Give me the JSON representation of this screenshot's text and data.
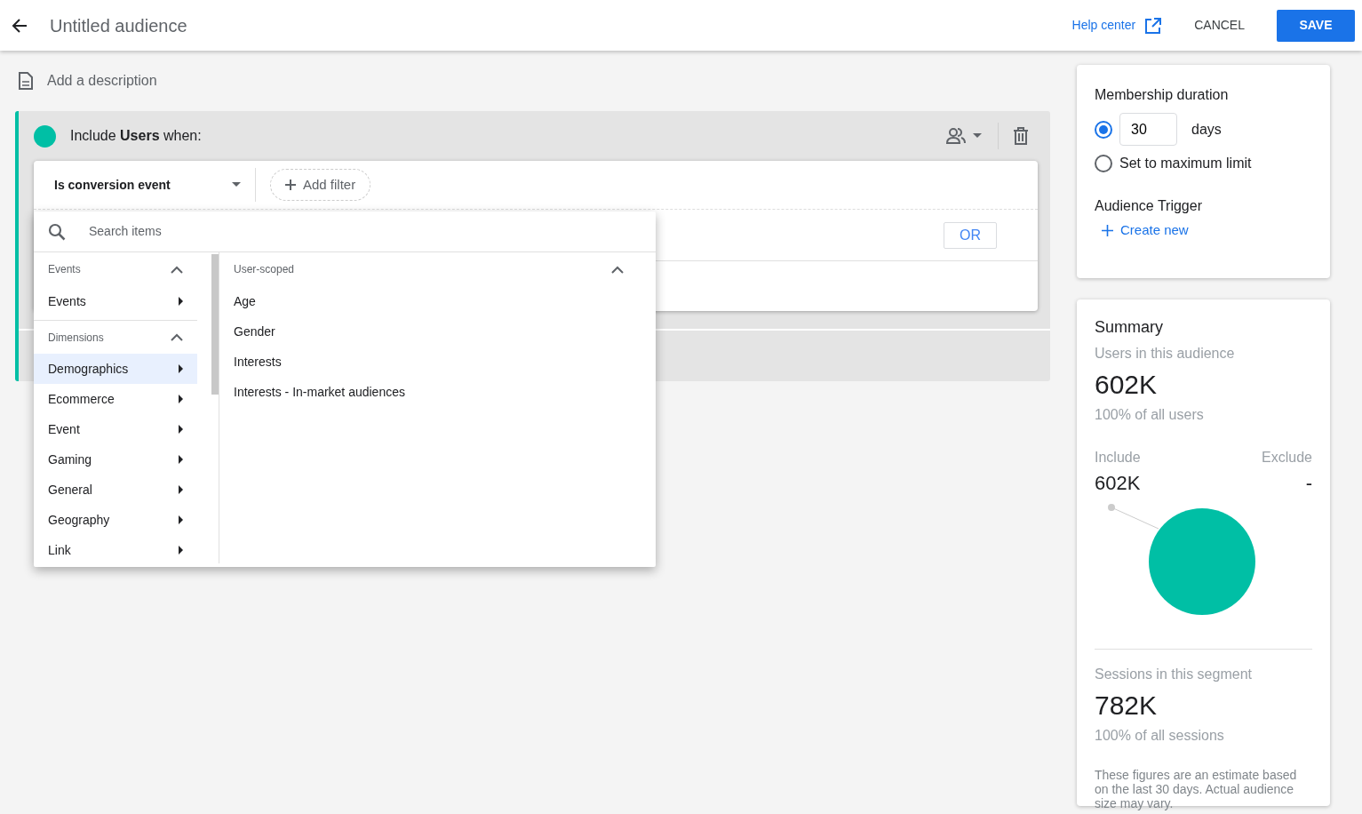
{
  "header": {
    "title": "Untitled audience",
    "help_link": "Help center",
    "cancel": "CANCEL",
    "save": "SAVE"
  },
  "description": {
    "placeholder": "Add a description"
  },
  "group": {
    "heading": "Include **Users** when:",
    "condition": "Is conversion event",
    "add_filter": "Add filter",
    "or_button": "OR"
  },
  "menu": {
    "search_placeholder": "Search items",
    "sections": [
      {
        "heading": "Events",
        "expanded": true,
        "items": [
          {
            "label": "Events",
            "selected": false
          }
        ]
      },
      {
        "heading": "Dimensions",
        "expanded": true,
        "items": [
          {
            "label": "Demographics",
            "selected": true
          },
          {
            "label": "Ecommerce",
            "selected": false
          },
          {
            "label": "Event",
            "selected": false
          },
          {
            "label": "Gaming",
            "selected": false
          },
          {
            "label": "General",
            "selected": false
          },
          {
            "label": "Geography",
            "selected": false
          },
          {
            "label": "Link",
            "selected": false
          }
        ]
      }
    ],
    "detail": {
      "heading": "User-scoped",
      "expanded": true,
      "items": [
        "Age",
        "Gender",
        "Interests",
        "Interests - In-market audiences"
      ]
    }
  },
  "membership": {
    "title": "Membership duration",
    "options": [
      {
        "kind": "days",
        "selected": true,
        "value": "30",
        "unit": "days"
      },
      {
        "kind": "label",
        "selected": false,
        "label": "Set to maximum limit"
      }
    ],
    "trigger_title": "Audience Trigger",
    "create_new": "Create new"
  },
  "summary": {
    "title": "Summary",
    "users_label": "Users in this audience",
    "users_value": "602K",
    "users_share": "100% of all users",
    "include_label": "Include",
    "include_value": "602K",
    "exclude_label": "Exclude",
    "exclude_value": "-",
    "sessions_label": "Sessions in this segment",
    "sessions_value": "782K",
    "sessions_share": "100% of all sessions",
    "note": "These figures are an estimate based on the last 30 days. Actual audience size may vary."
  }
}
